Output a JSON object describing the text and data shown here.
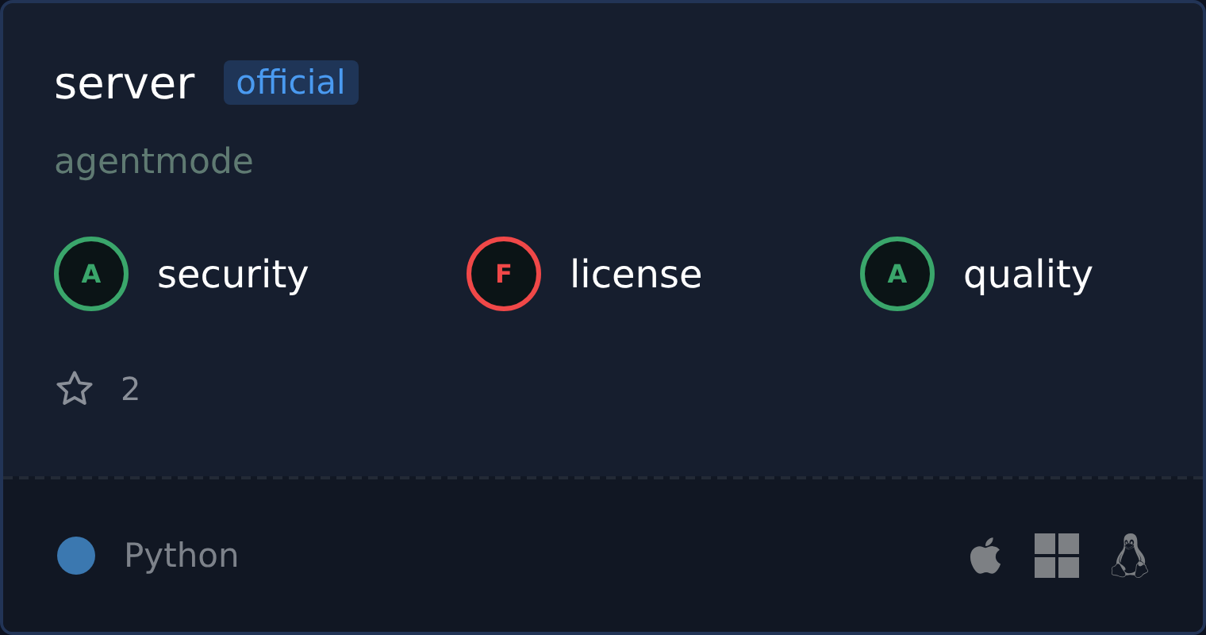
{
  "title": "server",
  "badge": "official",
  "owner": "agentmode",
  "scores": [
    {
      "grade": "A",
      "label": "security",
      "color": "#3aa66b"
    },
    {
      "grade": "F",
      "label": "license",
      "color": "#f04848"
    },
    {
      "grade": "A",
      "label": "quality",
      "color": "#3aa66b"
    }
  ],
  "stars": "2",
  "language": {
    "name": "Python",
    "color": "#3b78b0"
  },
  "platforms": [
    {
      "kind": "apple"
    },
    {
      "kind": "windows"
    },
    {
      "kind": "linux"
    }
  ]
}
